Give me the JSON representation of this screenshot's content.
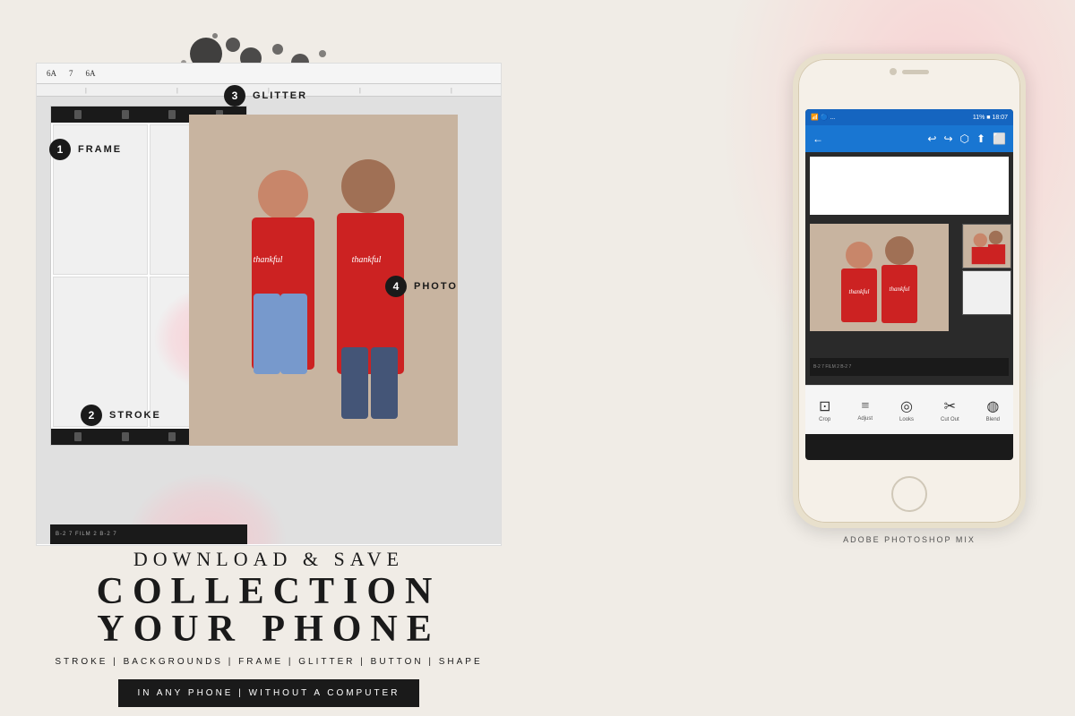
{
  "background": {
    "color": "#f0ece6"
  },
  "badges": {
    "frame": {
      "number": "1",
      "label": "FRAME"
    },
    "stroke": {
      "number": "2",
      "label": "STROKE"
    },
    "glitter": {
      "number": "3",
      "label": "GLITTER"
    },
    "photo": {
      "number": "4",
      "label": "PHOTO"
    }
  },
  "headings": {
    "download_save": "DOWNLOAD & SAVE",
    "collection": "COLLECTION",
    "your_phone": "YOUR PHONE"
  },
  "features": "STROKE | BACKGROUNDS | FRAME | GLITTER | BUTTON | SHAPE",
  "cta_button": "IN ANY PHONE | WITHOUT A COMPUTER",
  "phone_label": "ADOBE PHOTOSHOP MIX",
  "app": {
    "status_left": "🔋 📶 ...",
    "status_right": "11% ⬛ 18:07",
    "toolbar_icons": [
      "←",
      "↩",
      "↪",
      "⬡",
      "⬆",
      "⬜"
    ]
  },
  "app_tools": [
    {
      "icon": "⊡",
      "label": "Crop"
    },
    {
      "icon": "≡",
      "label": "Adjust"
    },
    {
      "icon": "◎",
      "label": "Looks"
    },
    {
      "icon": "✂",
      "label": "Cut Out"
    },
    {
      "icon": "◍",
      "label": "Blend"
    }
  ],
  "film_labels": {
    "bottom": "B-2    7    FILM 2  B-2         7"
  }
}
